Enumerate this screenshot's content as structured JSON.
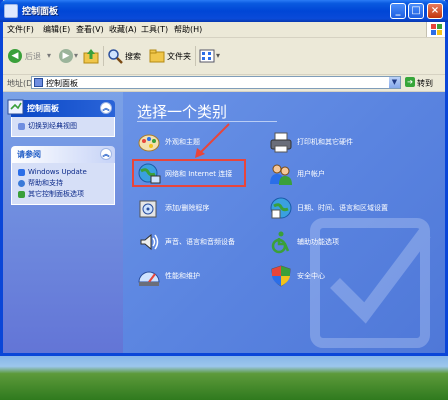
{
  "window": {
    "title": "控制面板"
  },
  "menu": {
    "items": [
      "文件(F)",
      "编辑(E)",
      "查看(V)",
      "收藏(A)",
      "工具(T)",
      "帮助(H)"
    ]
  },
  "toolbar": {
    "back": "后退",
    "search": "搜索",
    "folders": "文件夹"
  },
  "address": {
    "label": "地址(D)",
    "value": "控制面板",
    "go": "转到"
  },
  "sidebar": {
    "panel1": {
      "title": "控制面板",
      "link": "切换到经典视图"
    },
    "panel2": {
      "title": "请参阅",
      "links": [
        "Windows Update",
        "帮助和支持",
        "其它控制面板选项"
      ]
    }
  },
  "main": {
    "title": "选择一个类别",
    "categories": [
      {
        "label": "外观和主题",
        "icon": "appearance-icon"
      },
      {
        "label": "打印机和其它硬件",
        "icon": "printer-icon"
      },
      {
        "label": "网络和 Internet 连接",
        "icon": "network-icon"
      },
      {
        "label": "用户帐户",
        "icon": "users-icon"
      },
      {
        "label": "添加/删除程序",
        "icon": "add-remove-icon"
      },
      {
        "label": "日期、时间、语言和区域设置",
        "icon": "date-time-icon"
      },
      {
        "label": "声音、语言和音频设备",
        "icon": "sound-icon"
      },
      {
        "label": "辅助功能选项",
        "icon": "accessibility-icon"
      },
      {
        "label": "性能和维护",
        "icon": "performance-icon"
      },
      {
        "label": "安全中心",
        "icon": "security-shield-icon"
      }
    ]
  },
  "colors": {
    "titlebar": "#0a46d8",
    "sidebar": "#6f8ee0",
    "main": "#5a84e0",
    "highlight": "#e8453b"
  }
}
